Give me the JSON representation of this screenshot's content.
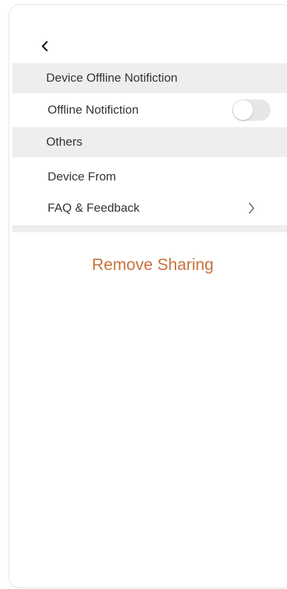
{
  "header": {
    "back_icon": "chevron-left-icon"
  },
  "sections": {
    "offline_header": "Device Offline Notifiction",
    "offline_notification_label": "Offline Notifiction",
    "offline_notification_enabled": false,
    "others_header": "Others",
    "device_from_label": "Device From",
    "faq_label": "FAQ & Feedback",
    "faq_icon": "chevron-right-icon"
  },
  "actions": {
    "remove_label": "Remove Sharing"
  },
  "colors": {
    "accent": "#c8733f",
    "section_bg": "#eeeeee",
    "toggle_off": "#e6e6e6"
  }
}
